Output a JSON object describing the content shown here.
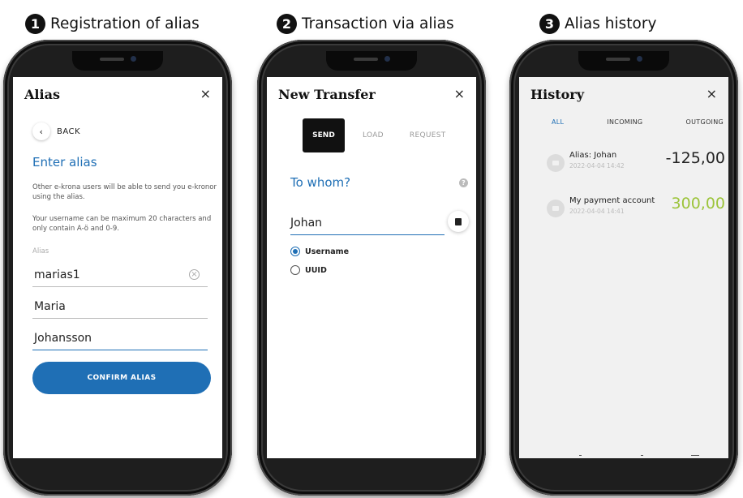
{
  "steps": [
    {
      "number": "1",
      "title": "Registration of alias"
    },
    {
      "number": "2",
      "title": "Transaction via alias"
    },
    {
      "number": "3",
      "title": "Alias history"
    }
  ],
  "alias_screen": {
    "title": "Alias",
    "close_icon": "×",
    "back_label": "BACK",
    "heading": "Enter alias",
    "desc1": "Other e-krona users will be able to send you e-kronor using the alias.",
    "desc2": "Your username can be maximum 20 characters and only contain A-ö and 0-9.",
    "field_label": "Alias",
    "alias_value": "marias1",
    "first_name": "Maria",
    "last_name": "Johansson",
    "confirm_label": "CONFIRM ALIAS"
  },
  "transfer_screen": {
    "title": "New Transfer",
    "close_icon": "×",
    "tabs": [
      "SEND",
      "LOAD",
      "REQUEST"
    ],
    "heading": "To whom?",
    "help_icon": "?",
    "recipient_value": "Johan",
    "options": [
      "Username",
      "UUID"
    ],
    "selected_option": "Username"
  },
  "history_screen": {
    "title": "History",
    "close_icon": "×",
    "tabs": [
      "ALL",
      "INCOMING",
      "OUTGOING"
    ],
    "selected_tab": "ALL",
    "items": [
      {
        "name": "Alias: Johan",
        "date": "2022-04-04 14:42",
        "amount": "-125,00",
        "color": "#222222"
      },
      {
        "name": "My payment account",
        "date": "2022-04-04 14:41",
        "amount": "300,00",
        "color": "#9cc43a"
      }
    ]
  },
  "colors": {
    "accent": "#1f6fb5",
    "positive": "#9cc43a"
  }
}
